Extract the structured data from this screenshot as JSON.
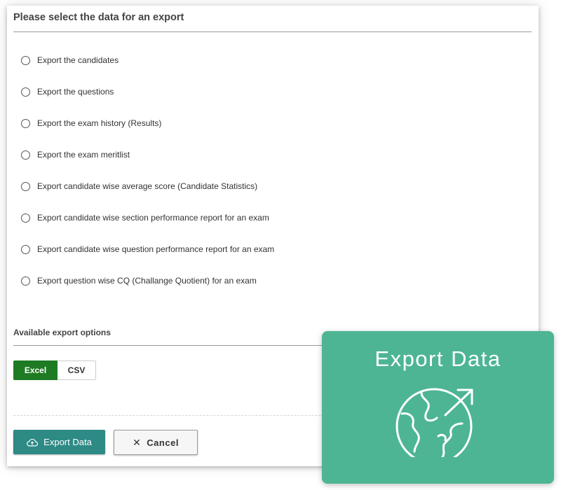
{
  "header": {
    "title": "Please select the data for an export"
  },
  "options": [
    "Export the candidates",
    "Export the questions",
    "Export the exam history (Results)",
    "Export the exam meritlist",
    "Export candidate wise average score (Candidate Statistics)",
    "Export candidate wise section performance report for an exam",
    "Export candidate wise question performance report for an exam",
    "Export question wise CQ (Challange Quotient) for an exam"
  ],
  "export_options": {
    "title": "Available export options",
    "formats": [
      "Excel",
      "CSV"
    ],
    "selected": "Excel"
  },
  "actions": {
    "export_label": "Export Data",
    "export_icon": "cloud-upload-icon",
    "cancel_label": "Cancel",
    "cancel_icon": "close-icon"
  },
  "promo": {
    "title": "Export Data",
    "icon": "globe-export-icon"
  },
  "colors": {
    "accent_green": "#1e7b23",
    "button_teal": "#2d8a85",
    "promo_green": "#4db594"
  }
}
